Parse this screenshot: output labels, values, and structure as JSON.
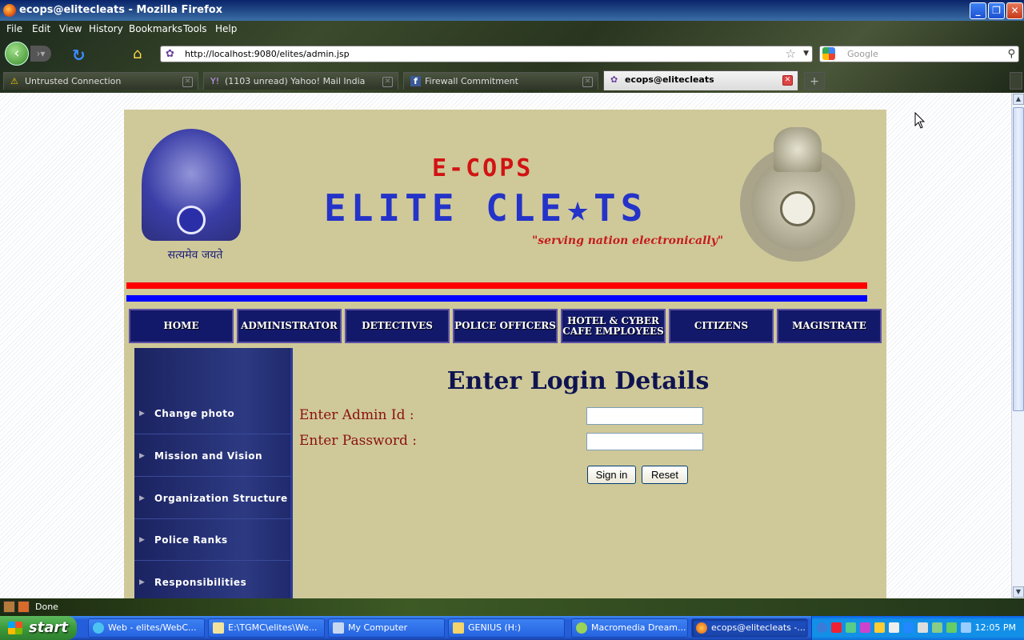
{
  "window": {
    "title": "ecops@elitecleats - Mozilla Firefox"
  },
  "menubar": [
    "File",
    "Edit",
    "View",
    "History",
    "Bookmarks",
    "Tools",
    "Help"
  ],
  "navigation": {
    "url": "http://localhost:9080/elites/admin.jsp",
    "search_placeholder": "Google"
  },
  "tabs": [
    {
      "label": "Untrusted Connection",
      "icon": "warning-icon"
    },
    {
      "label": "(1103 unread) Yahoo! Mail India",
      "icon": "yahoo-icon"
    },
    {
      "label": "Firewall Commitment",
      "icon": "facebook-icon"
    },
    {
      "label": "ecops@elitecleats",
      "icon": "site-icon",
      "active": true
    }
  ],
  "site": {
    "logo_line1": "E-COPS",
    "logo_line2": "ELITE CLE★TS",
    "tagline": "\"serving nation electronically\"",
    "emblem_motto": "सत्यमेव जयते",
    "nav": [
      "HOME",
      "ADMINISTRATOR",
      "DETECTIVES",
      "POLICE OFFICERS",
      "HOTEL & CYBER CAFE EMPLOYEES",
      "CITIZENS",
      "MAGISTRATE"
    ],
    "sidebar": [
      "Change photo",
      "Mission and Vision",
      "Organization Structure",
      "Police Ranks",
      "Responsibilities"
    ],
    "form": {
      "heading": "Enter Login Details",
      "admin_id_label": "Enter Admin Id :",
      "password_label": "Enter Password :",
      "admin_id_value": "",
      "password_value": "",
      "signin_label": "Sign in",
      "reset_label": "Reset"
    },
    "colors": {
      "page_bg": "#cfc999",
      "nav_bg": "#13196a",
      "label_red": "#8b1010"
    }
  },
  "statusbar": {
    "text": "Done"
  },
  "taskbar": {
    "start_label": "start",
    "tasks": [
      "Web - elites/WebC...",
      "E:\\TGMC\\elites\\We...",
      "My Computer",
      "GENIUS (H:)",
      "Macromedia Dream...",
      "ecops@elitecleats -..."
    ],
    "clock": "12:05 PM"
  }
}
